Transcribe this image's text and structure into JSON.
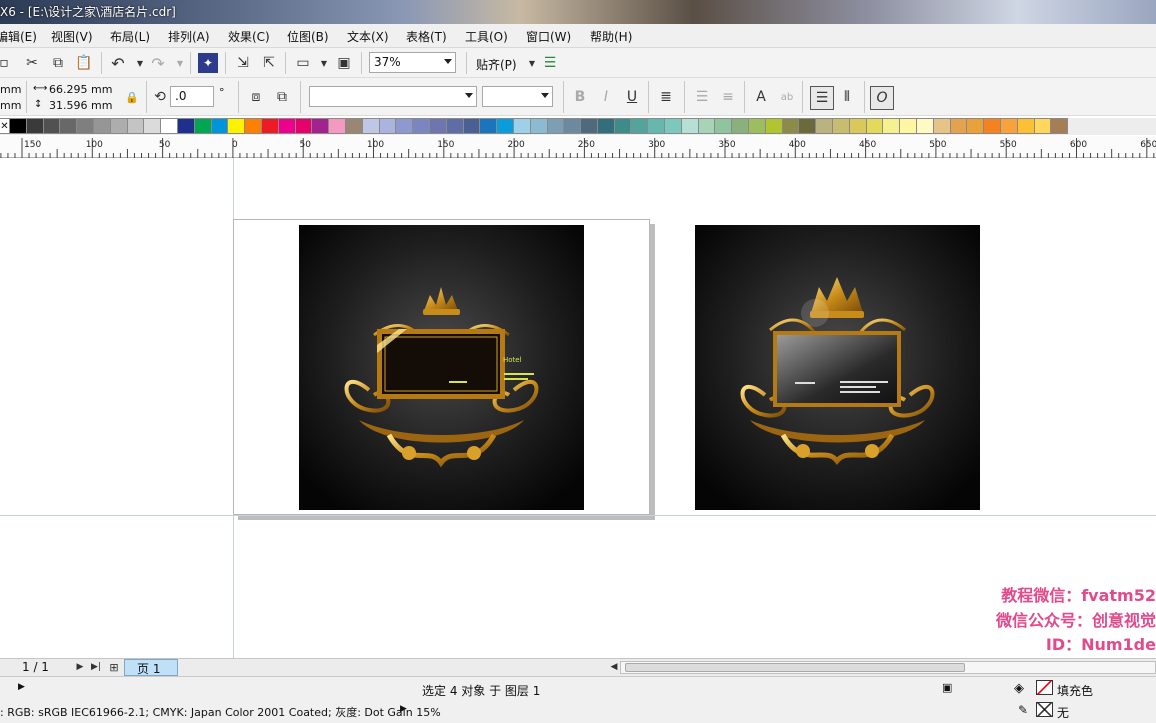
{
  "title_bar": {
    "title": "X6 - [E:\\设计之家\\酒店名片.cdr]"
  },
  "menu": [
    {
      "label": "编辑(E)"
    },
    {
      "label": "视图(V)"
    },
    {
      "label": "布局(L)"
    },
    {
      "label": "排列(A)"
    },
    {
      "label": "效果(C)"
    },
    {
      "label": "位图(B)"
    },
    {
      "label": "文本(X)"
    },
    {
      "label": "表格(T)"
    },
    {
      "label": "工具(O)"
    },
    {
      "label": "窗口(W)"
    },
    {
      "label": "帮助(H)"
    }
  ],
  "toolbar": {
    "zoom": "37%",
    "snap_label": "贴齐(P)"
  },
  "property_bar": {
    "unit_top": "mm",
    "unit_bottom": "mm",
    "width": "66.295 mm",
    "height": "31.596 mm",
    "rotation": ".0",
    "degree_symbol": "°"
  },
  "palette": [
    "#000000",
    "#3a3a3a",
    "#515151",
    "#686868",
    "#7f7f7f",
    "#969696",
    "#adadad",
    "#c4c4c4",
    "#dbdbdb",
    "#ffffff",
    "#1e2f8e",
    "#00a651",
    "#0094da",
    "#fff200",
    "#ff7f00",
    "#ed1c24",
    "#ec008c",
    "#e5006a",
    "#a3238e",
    "#f49ac1",
    "#998675",
    "#c0c7e4",
    "#aab4de",
    "#8e99cf",
    "#7b86c0",
    "#6f76ae",
    "#5e6da6",
    "#4a5f93",
    "#1b75bc",
    "#0b9ddb",
    "#9fd0e9",
    "#8abbd3",
    "#7d9fb5",
    "#6b8aa0",
    "#4e6a7d",
    "#336f7a",
    "#3e8c8a",
    "#53a59c",
    "#66b8ae",
    "#7dc8bd",
    "#b6e0d5",
    "#a7d4b6",
    "#8fc49d",
    "#8ab17d",
    "#9dbd5e",
    "#b3c431",
    "#8d8b4a",
    "#6b6a3d",
    "#bab37f",
    "#c8bd6e",
    "#d9c95a",
    "#e5d95b",
    "#f7f08f",
    "#fff6a3",
    "#fff9c4",
    "#e6c387",
    "#e4a24e",
    "#e9a13a",
    "#f58220",
    "#f9a13a",
    "#fcc035",
    "#ffd75c",
    "#a57e53"
  ],
  "ruler": {
    "ticks": [
      "150",
      "100",
      "50",
      "0",
      "50",
      "100",
      "150",
      "200",
      "250",
      "300",
      "350",
      "400",
      "450",
      "500",
      "550",
      "600",
      "650"
    ]
  },
  "watermark": {
    "line1": "教程微信：fvatm52",
    "line2": "微信公众号：创意视觉",
    "line3": "ID：Num1de"
  },
  "card_text": {
    "small_label": "Hotel"
  },
  "pagebar": {
    "page_count": "1 / 1",
    "tab_label": "页 1"
  },
  "status": {
    "selection": "选定 4 对象 于 图层 1",
    "color_profile": ": RGB: sRGB IEC61966-2.1; CMYK: Japan Color 2001 Coated; 灰度: Dot Gain 15%",
    "fill_label": "填充色",
    "outline_label": "无"
  }
}
